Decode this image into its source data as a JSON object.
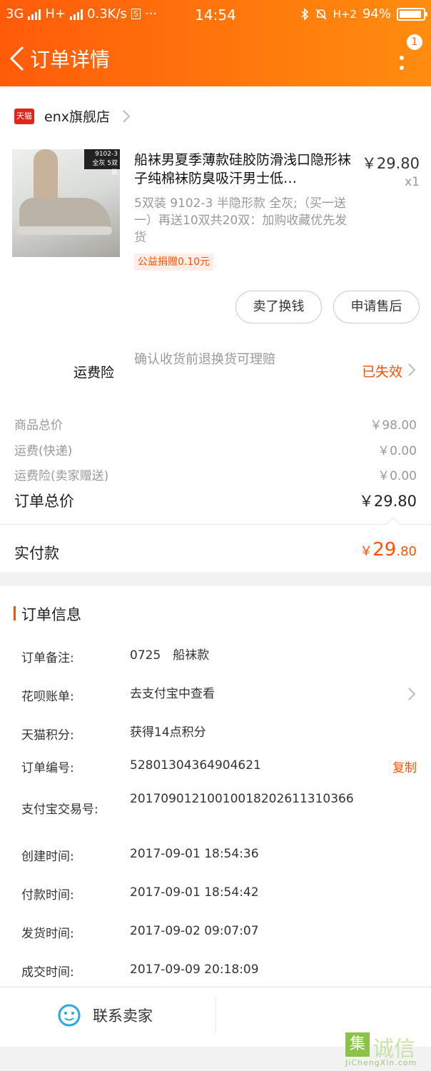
{
  "status_bar": {
    "network1": "3G",
    "network2": "H+",
    "speed": "0.3K/s",
    "sim_icon": "S",
    "dots": "···",
    "time": "14:54",
    "net3": "H+2",
    "battery": "94%",
    "battery_level": 0.94
  },
  "nav": {
    "title": "订单详情",
    "badge": "1"
  },
  "shop": {
    "logo_text": "天猫",
    "name": "enx旗舰店"
  },
  "product": {
    "title": "船袜男夏季薄款硅胶防滑浅口隐形袜子纯棉袜防臭吸汗男士低…",
    "price": "￥29.80",
    "qty": "x1",
    "sku": "5双装 9102-3 半隐形款 全灰;（买一送一）再送10双共20双：加购收藏优先发货",
    "image_tag_line1": "9102-3",
    "image_tag_line2": "全灰 5双装",
    "charity_tag": "公益捐赠0.10元"
  },
  "actions": {
    "sell": "卖了换钱",
    "after_sale": "申请售后"
  },
  "insurance": {
    "label": "运费险",
    "desc": "确认收货前退换货可理赔",
    "status": "已失效"
  },
  "fees": {
    "goods_label": "商品总价",
    "goods_value": "￥98.00",
    "shipping_label": "运费(快递)",
    "shipping_value": "￥0.00",
    "ins_label": "运费险(卖家赠送)",
    "ins_value": "￥0.00",
    "total_label": "订单总价",
    "total_value": "￥29.80"
  },
  "paid": {
    "label": "实付款",
    "currency": "￥",
    "int": "29",
    "dec": ".80"
  },
  "order_info": {
    "title": "订单信息",
    "note_label": "订单备注:",
    "note_value": "0725　船袜款",
    "huabei_label": "花呗账单:",
    "huabei_value": "去支付宝中查看",
    "points_label": "天猫积分:",
    "points_value": "获得14点积分",
    "order_no_label": "订单编号:",
    "order_no_value": "52801304364904621",
    "copy": "复制",
    "alipay_label": "支付宝交易号:",
    "alipay_value": "20170901210010018202611310366",
    "created_label": "创建时间:",
    "created_value": "2017-09-01 18:54:36",
    "paid_label": "付款时间:",
    "paid_value": "2017-09-01 18:54:42",
    "shipped_label": "发货时间:",
    "shipped_value": "2017-09-02 09:07:07",
    "closed_label": "成交时间:",
    "closed_value": "2017-09-09 20:18:09"
  },
  "footer": {
    "contact": "联系卖家"
  },
  "watermark": {
    "box": "集",
    "text": "诚信",
    "sub": "JiChengXin.com"
  }
}
